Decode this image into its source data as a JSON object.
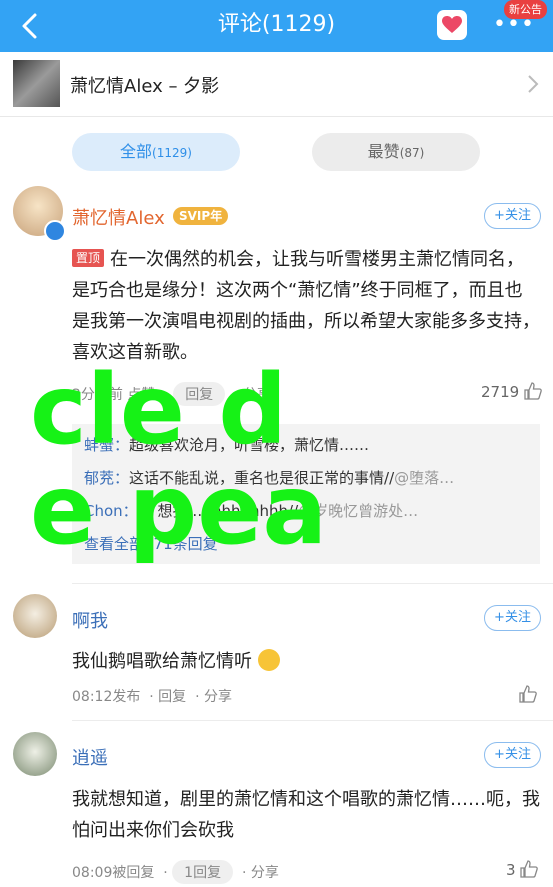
{
  "header": {
    "title": "评论(1129)",
    "notice_badge": "新公告"
  },
  "song": {
    "title": "萧忆情Alex – 夕影"
  },
  "tabs": [
    {
      "label": "全部",
      "count": "(1129)"
    },
    {
      "label": "最赞",
      "count": "(87)"
    }
  ],
  "follow_label": "+关注",
  "comments": [
    {
      "user": "萧忆情Alex",
      "badge": "SVIP年",
      "pin_label": "置顶",
      "text": "在一次偶然的机会，让我与听雪楼男主萧忆情同名，是巧合也是缘分！这次两个“萧忆情”终于同框了，而且也是我第一次演唱电视剧的插曲，所以希望大家能多多支持，喜欢这首新歌。",
      "time": "2分钟前",
      "liked_by": "点赞",
      "reply_label": "回复",
      "share_label": "分享",
      "likes": "2719",
      "replies": [
        {
          "name": "蚌蟹：",
          "text": "超级喜欢沧月，听雪楼，萧忆情……",
          "mention": ""
        },
        {
          "name": "郁茺：",
          "text": "这话不能乱说，重名也是很正常的事情//",
          "mention": "@堕落…"
        },
        {
          "name": "Chon：",
          "text": "… 想打 … hhhhhhhh//",
          "mention": "@岁晚忆曾游处…"
        }
      ],
      "view_all": "查看全部171条回复"
    },
    {
      "user": "啊我",
      "text": "我仙鹅唱歌给萧忆情听",
      "time": "08:12发布",
      "reply_label": "回复",
      "share_label": "分享"
    },
    {
      "user": "逍遥",
      "text": "我就想知道，剧里的萧忆情和这个唱歌的萧忆情……呃，我怕问出来你们会砍我",
      "time": "08:09被回复",
      "reply_label": "1回复",
      "share_label": "分享",
      "likes": "3"
    }
  ],
  "overlay_text": {
    "line1": "cle d",
    "line2": "e pea"
  },
  "colors": {
    "topbar": "#33a3f4",
    "link": "#3b6fb8",
    "overlay": "#16f216",
    "pin": "#e65451",
    "svip": "#f0b33e"
  }
}
